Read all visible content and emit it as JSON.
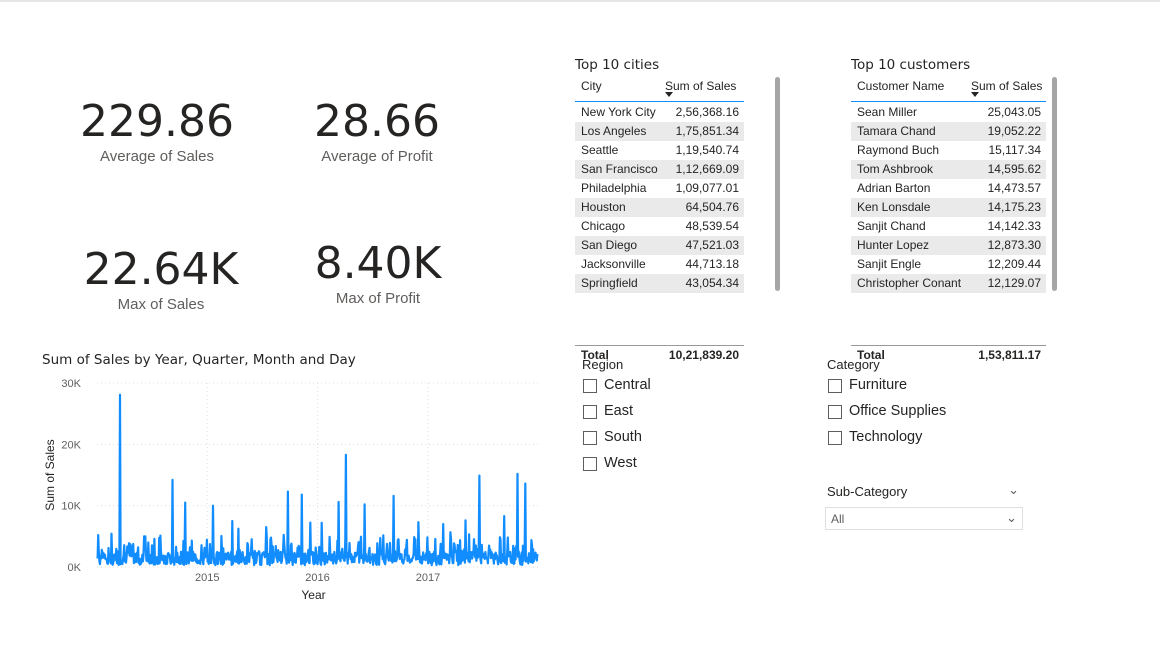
{
  "kpis": [
    {
      "value": "229.86",
      "label": "Average of Sales"
    },
    {
      "value": "28.66",
      "label": "Average of Profit"
    },
    {
      "value": "22.64K",
      "label": "Max of Sales"
    },
    {
      "value": "8.40K",
      "label": "Max of Profit"
    }
  ],
  "cities_table": {
    "title": "Top 10 cities",
    "col1": "City",
    "col2": "Sum of Sales",
    "rows": [
      [
        "New York City",
        "2,56,368.16"
      ],
      [
        "Los Angeles",
        "1,75,851.34"
      ],
      [
        "Seattle",
        "1,19,540.74"
      ],
      [
        "San Francisco",
        "1,12,669.09"
      ],
      [
        "Philadelphia",
        "1,09,077.01"
      ],
      [
        "Houston",
        "64,504.76"
      ],
      [
        "Chicago",
        "48,539.54"
      ],
      [
        "San Diego",
        "47,521.03"
      ],
      [
        "Jacksonville",
        "44,713.18"
      ],
      [
        "Springfield",
        "43,054.34"
      ]
    ],
    "total_label": "Total",
    "total_value": "10,21,839.20"
  },
  "customers_table": {
    "title": "Top 10 customers",
    "col1": "Customer Name",
    "col2": "Sum of Sales",
    "rows": [
      [
        "Sean Miller",
        "25,043.05"
      ],
      [
        "Tamara Chand",
        "19,052.22"
      ],
      [
        "Raymond Buch",
        "15,117.34"
      ],
      [
        "Tom Ashbrook",
        "14,595.62"
      ],
      [
        "Adrian Barton",
        "14,473.57"
      ],
      [
        "Ken Lonsdale",
        "14,175.23"
      ],
      [
        "Sanjit Chand",
        "14,142.33"
      ],
      [
        "Hunter Lopez",
        "12,873.30"
      ],
      [
        "Sanjit Engle",
        "12,209.44"
      ],
      [
        "Christopher Conant",
        "12,129.07"
      ]
    ],
    "total_label": "Total",
    "total_value": "1,53,811.17"
  },
  "chart_data": {
    "type": "line",
    "title": "Sum of Sales by Year, Quarter, Month and Day",
    "xlabel": "Year",
    "ylabel": "Sum of Sales",
    "x_ticks": [
      "2015",
      "2016",
      "2017"
    ],
    "y_ticks": [
      "0K",
      "10K",
      "20K",
      "30K"
    ],
    "ylim": [
      0,
      30000
    ],
    "xlim": [
      "2014-01-01",
      "2017-12-31"
    ],
    "grid": true,
    "color": "#118dff",
    "peaks": [
      {
        "date": "2014-01-06",
        "value": 5200
      },
      {
        "date": "2014-03-18",
        "value": 28100
      },
      {
        "date": "2014-06-10",
        "value": 5000
      },
      {
        "date": "2014-09-08",
        "value": 14200
      },
      {
        "date": "2014-10-20",
        "value": 10500
      },
      {
        "date": "2015-01-20",
        "value": 10000
      },
      {
        "date": "2015-03-25",
        "value": 7500
      },
      {
        "date": "2015-07-15",
        "value": 6500
      },
      {
        "date": "2015-09-25",
        "value": 12300
      },
      {
        "date": "2015-11-10",
        "value": 11800
      },
      {
        "date": "2016-01-15",
        "value": 7200
      },
      {
        "date": "2016-03-12",
        "value": 10600
      },
      {
        "date": "2016-04-05",
        "value": 18300
      },
      {
        "date": "2016-06-05",
        "value": 10200
      },
      {
        "date": "2016-09-10",
        "value": 11600
      },
      {
        "date": "2016-12-01",
        "value": 7300
      },
      {
        "date": "2017-02-20",
        "value": 7000
      },
      {
        "date": "2017-05-05",
        "value": 7600
      },
      {
        "date": "2017-06-20",
        "value": 14900
      },
      {
        "date": "2017-09-10",
        "value": 8300
      },
      {
        "date": "2017-10-25",
        "value": 15200
      },
      {
        "date": "2017-11-20",
        "value": 13600
      }
    ]
  },
  "region": {
    "title": "Region",
    "options": [
      "Central",
      "East",
      "South",
      "West"
    ]
  },
  "category": {
    "title": "Category",
    "options": [
      "Furniture",
      "Office Supplies",
      "Technology"
    ]
  },
  "subcategory": {
    "title": "Sub-Category",
    "selected": "All"
  }
}
